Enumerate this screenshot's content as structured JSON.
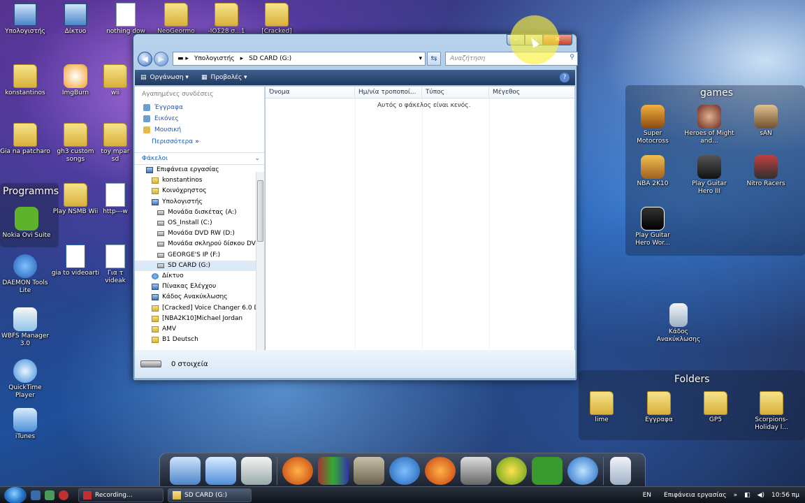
{
  "desktop": {
    "left_icons": [
      {
        "label": "Υπολογιστής",
        "icon": "computer-icon"
      },
      {
        "label": "Δίκτυο",
        "icon": "network-icon"
      },
      {
        "label": "nothing dow",
        "icon": "document-icon"
      },
      {
        "label": "NeoGeormo",
        "icon": "folder-icon"
      },
      {
        "label": "-ΙΟΣ28 σ...1",
        "icon": "folder-icon"
      },
      {
        "label": "[Cracked]",
        "icon": "folder-icon"
      },
      {
        "label": "konstantinos",
        "icon": "folder-icon"
      },
      {
        "label": "ImgBurn",
        "icon": "imgburn-icon"
      },
      {
        "label": "wii",
        "icon": "folder-icon"
      },
      {
        "label": "Gia na patcharo",
        "icon": "folder-icon"
      },
      {
        "label": "gh3 custom songs",
        "icon": "folder-icon"
      },
      {
        "label": "toy mpar sd",
        "icon": "folder-icon"
      },
      {
        "label": "Play NSMB Wii",
        "icon": "folder-icon"
      },
      {
        "label": "http---w",
        "icon": "document-icon"
      },
      {
        "label": "Nokia Ovi Suite",
        "icon": "ovi-icon"
      },
      {
        "label": "gia to videoarti",
        "icon": "word-document-icon"
      },
      {
        "label": "Για τ videak",
        "icon": "document-icon"
      },
      {
        "label": "DAEMON Tools Lite",
        "icon": "daemon-tools-icon"
      },
      {
        "label": "WBFS Manager 3.0",
        "icon": "wbfs-icon"
      },
      {
        "label": "QuickTime Player",
        "icon": "quicktime-icon"
      },
      {
        "label": "iTunes",
        "icon": "itunes-icon"
      }
    ],
    "programms_title": "Programms",
    "games_title": "games",
    "games": [
      {
        "label": "Super Motocross",
        "icon": "game-icon"
      },
      {
        "label": "Heroes of Might and...",
        "icon": "game-icon"
      },
      {
        "label": "sAN",
        "icon": "game-icon"
      },
      {
        "label": "NBA 2K10",
        "icon": "game-icon"
      },
      {
        "label": "Play Guitar Hero III",
        "icon": "game-icon"
      },
      {
        "label": "Nitro Racers",
        "icon": "game-icon"
      },
      {
        "label": "Play Guitar Hero Wor...",
        "icon": "game-icon"
      }
    ],
    "recycle_bin": "Κάδος Ανακύκλωσης",
    "folders_title": "Folders",
    "folders": [
      {
        "label": "lime",
        "icon": "folder-icon"
      },
      {
        "label": "Εγγραφα",
        "icon": "folder-icon"
      },
      {
        "label": "GP5",
        "icon": "folder-icon"
      },
      {
        "label": "Scorpions-Holiday l...",
        "icon": "folder-icon"
      }
    ]
  },
  "window": {
    "title": "SD CARD (G:)",
    "caption": {
      "minimize": "–",
      "maximize": "□",
      "close": "✕"
    },
    "address": {
      "segments": [
        "Υπολογιστής",
        "SD CARD (G:)"
      ]
    },
    "search_placeholder": "Αναζήτηση",
    "toolbar": {
      "organize": "Οργάνωση",
      "views": "Προβολές"
    },
    "favorites_heading": "Αγαπημένες συνδέσεις",
    "favorites": [
      "Έγγραφα",
      "Εικόνες",
      "Μουσική"
    ],
    "more": "Περισσότερα",
    "folders_heading": "Φάκελοι",
    "tree": [
      {
        "label": "Επιφάνεια εργασίας",
        "level": 0,
        "icon": "blue"
      },
      {
        "label": "konstantinos",
        "level": 1,
        "icon": "folder"
      },
      {
        "label": "Κοινόχρηστος",
        "level": 1,
        "icon": "folder"
      },
      {
        "label": "Υπολογιστής",
        "level": 1,
        "icon": "blue"
      },
      {
        "label": "Μονάδα δισκέτας (A:)",
        "level": 2,
        "icon": "drive"
      },
      {
        "label": "OS_Install (C:)",
        "level": 2,
        "icon": "drive"
      },
      {
        "label": "Μονάδα DVD RW (D:)",
        "level": 2,
        "icon": "drive"
      },
      {
        "label": "Μονάδα σκληρού δίσκου DV",
        "level": 2,
        "icon": "drive"
      },
      {
        "label": "GEORGE'S IP (F:)",
        "level": 2,
        "icon": "drive"
      },
      {
        "label": "SD CARD (G:)",
        "level": 2,
        "icon": "drive",
        "selected": true
      },
      {
        "label": "Δίκτυο",
        "level": 1,
        "icon": "net"
      },
      {
        "label": "Πίνακας Ελέγχου",
        "level": 1,
        "icon": "blue"
      },
      {
        "label": "Κάδος Ανακύκλωσης",
        "level": 1,
        "icon": "blue"
      },
      {
        "label": "[Cracked] Voice Changer 6.0 D",
        "level": 1,
        "icon": "folder"
      },
      {
        "label": "[NBA2K10]Michael Jordan",
        "level": 1,
        "icon": "folder"
      },
      {
        "label": "AMV",
        "level": 1,
        "icon": "folder"
      },
      {
        "label": "B1 Deutsch",
        "level": 1,
        "icon": "folder"
      }
    ],
    "columns": [
      "Όνομα",
      "Ημ/νία τροποποί...",
      "Τύπος",
      "Μέγεθος"
    ],
    "empty_message": "Αυτός ο φάκελος είναι κενός.",
    "status": "0 στοιχεία"
  },
  "dock": {
    "icons": [
      "computer-icon",
      "itunes-icon",
      "drive-icon",
      "firefox-icon",
      "winrar-icon",
      "guitar-pro-icon",
      "daemon-tools-icon",
      "firefox-icon",
      "network-tools-icon",
      "limewire-icon",
      "utorrent-icon",
      "internet-explorer-icon",
      "recycle-bin-icon"
    ]
  },
  "taskbar": {
    "tasks": [
      {
        "label": "Recording...",
        "icon": "record-icon",
        "active": false
      },
      {
        "label": "SD CARD (G:)",
        "icon": "folder-icon",
        "active": true
      }
    ],
    "language": "EN",
    "desktop_label": "Επιφάνεια εργασίας",
    "time": "10:56 πμ"
  },
  "colors": {
    "accent": "#1f5bb8",
    "titlebar": "#b7d2ec",
    "toolbar": "#2d4a74"
  }
}
